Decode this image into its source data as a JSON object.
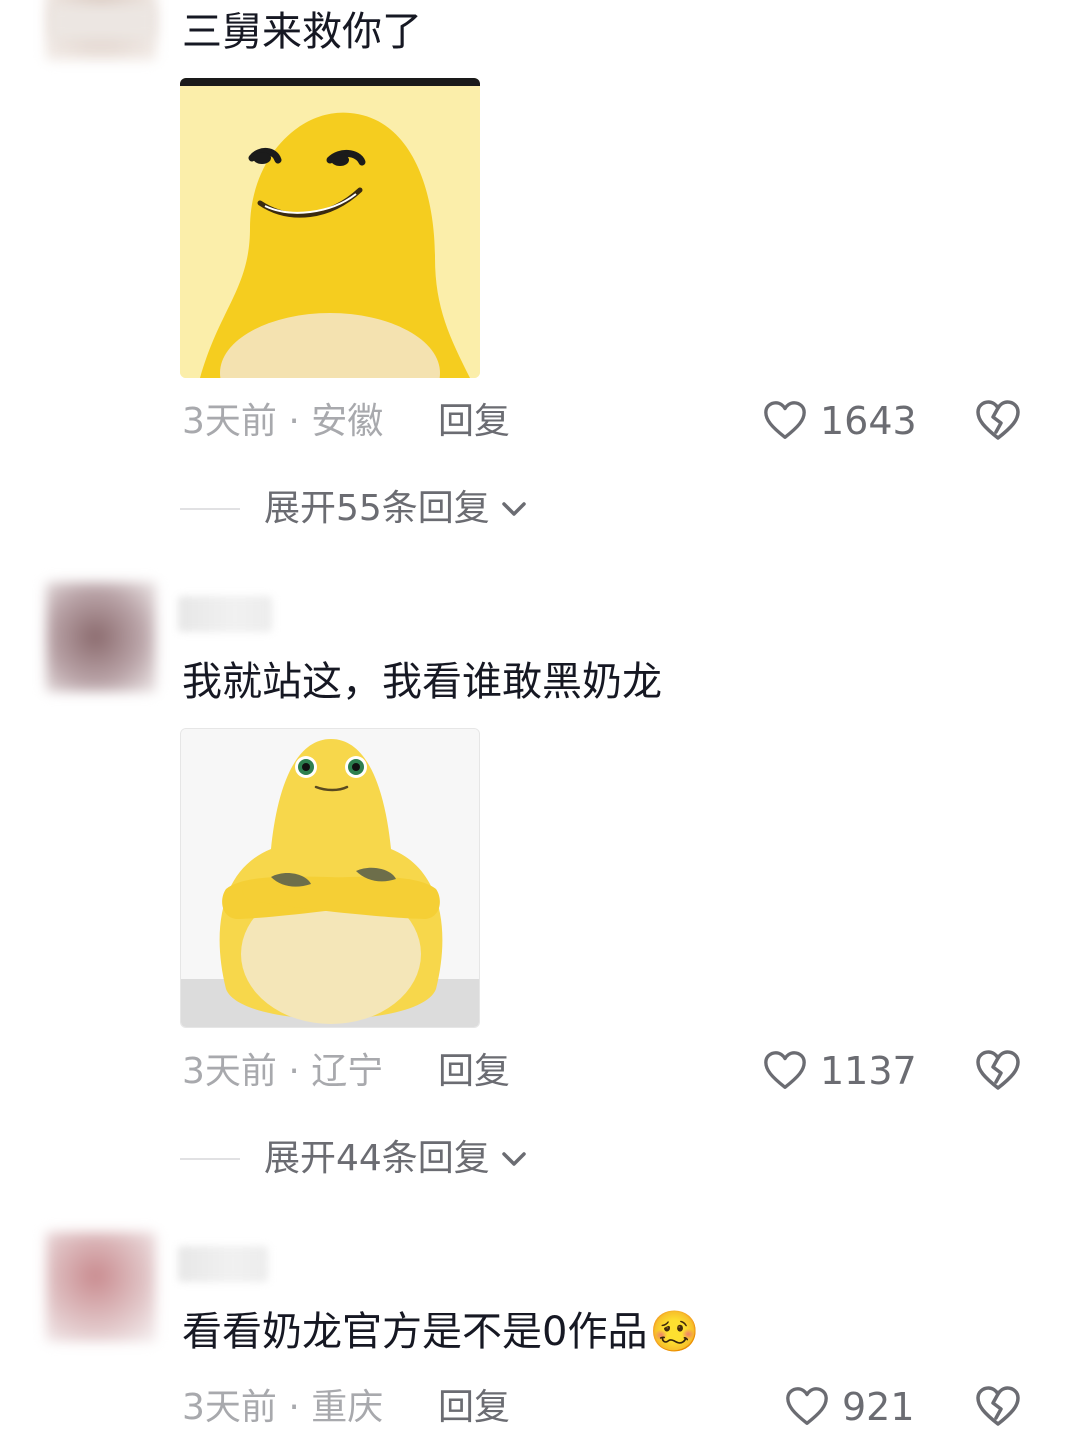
{
  "comments": [
    {
      "text": "三舅来救你了",
      "image_icon": "yellow-creature-smirk-image",
      "time": "3天前",
      "separator": "·",
      "location": "安徽",
      "reply_label": "回复",
      "likes": "1643",
      "expand_label": "展开55条回复"
    },
    {
      "text": "我就站这，我看谁敢黑奶龙",
      "image_icon": "yellow-creature-arms-crossed-image",
      "time": "3天前",
      "separator": "·",
      "location": "辽宁",
      "reply_label": "回复",
      "likes": "1137",
      "expand_label": "展开44条回复"
    },
    {
      "text": "看看奶龙官方是不是0作品",
      "emoji": "🥴",
      "time": "3天前",
      "separator": "·",
      "location": "重庆",
      "reply_label": "回复",
      "likes": "921"
    }
  ],
  "colors": {
    "text_primary": "#161823",
    "text_meta": "#a8a9ad",
    "text_secondary": "#6b6c72",
    "creature_yellow": "#f5d31c",
    "divider": "#e1e1e3"
  },
  "icons": {
    "like": "heart-outline-icon",
    "dislike": "broken-heart-icon",
    "expand": "chevron-down-icon"
  }
}
